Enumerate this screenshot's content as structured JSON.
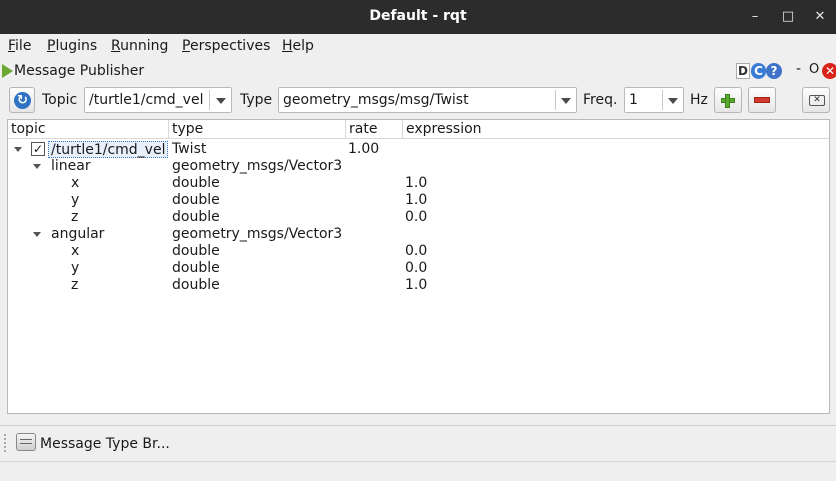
{
  "window": {
    "title": "Default - rqt",
    "minimize": "–",
    "maximize": "□",
    "close": "✕"
  },
  "menu": {
    "items": [
      {
        "mnemonic": "F",
        "rest": "ile"
      },
      {
        "mnemonic": "P",
        "rest": "lugins"
      },
      {
        "mnemonic": "R",
        "rest": "unning"
      },
      {
        "mnemonic": "P",
        "rest": "erspectives"
      },
      {
        "mnemonic": "H",
        "rest": "elp"
      }
    ]
  },
  "plugin": {
    "title": "Message Publisher",
    "buttons": {
      "dock": "D",
      "reload": "C",
      "help": "?",
      "minimize": "-",
      "float": "O",
      "close": "✕"
    }
  },
  "toolbar": {
    "topic_label": "Topic",
    "topic_value": "/turtle1/cmd_vel",
    "type_label": "Type",
    "type_value": "geometry_msgs/msg/Twist",
    "freq_label": "Freq.",
    "freq_value": "1",
    "freq_unit": "Hz"
  },
  "tree": {
    "headers": [
      "topic",
      "type",
      "rate",
      "expression"
    ],
    "rows": [
      {
        "topic": "/turtle1/cmd_vel",
        "type": "Twist",
        "rate": "1.00",
        "expression": "",
        "checked": true
      },
      {
        "topic": "linear",
        "type": "geometry_msgs/Vector3",
        "rate": "",
        "expression": ""
      },
      {
        "topic": "x",
        "type": "double",
        "rate": "",
        "expression": "1.0"
      },
      {
        "topic": "y",
        "type": "double",
        "rate": "",
        "expression": "1.0"
      },
      {
        "topic": "z",
        "type": "double",
        "rate": "",
        "expression": "0.0"
      },
      {
        "topic": "angular",
        "type": "geometry_msgs/Vector3",
        "rate": "",
        "expression": ""
      },
      {
        "topic": "x",
        "type": "double",
        "rate": "",
        "expression": "0.0"
      },
      {
        "topic": "y",
        "type": "double",
        "rate": "",
        "expression": "0.0"
      },
      {
        "topic": "z",
        "type": "double",
        "rate": "",
        "expression": "1.0"
      }
    ]
  },
  "dock": {
    "label": "Message Type Br..."
  },
  "icons": {
    "refresh": "refresh-icon",
    "add": "plus-icon",
    "remove": "minus-icon",
    "clear": "clear-icon"
  },
  "colors": {
    "titlebar": "#2c2c2c",
    "accent_green": "#57a82b",
    "accent_red": "#d23a2e",
    "accent_blue": "#2f72c4"
  }
}
